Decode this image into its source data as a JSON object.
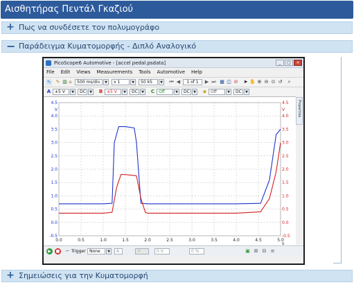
{
  "page": {
    "title": "Αισθητήρας Πεντάλ Γκαζιού",
    "sections": [
      {
        "label": "Πως να συνδέσετε τον πολυμογράφο",
        "symbol": "+"
      },
      {
        "label": "Παράδειγμα Κυματομορφής - Διπλό Αναλογικό",
        "symbol": "−"
      },
      {
        "label": "Σημειώσεις για την Κυματομορφή",
        "symbol": "+"
      }
    ]
  },
  "app": {
    "title": "PicoScope6 Automotive - [accel pedal.psdata]",
    "window_buttons": [
      "_",
      "□",
      "×"
    ],
    "menu": [
      "File",
      "Edit",
      "Views",
      "Measurements",
      "Tools",
      "Automotive",
      "Help"
    ],
    "toolbar1": {
      "timebase": "500 ms/div",
      "multiplier": "x 1",
      "samples": "50 kS",
      "buffer": "1 of 1"
    },
    "toolbar2": {
      "channel_a_label": "A",
      "channel_a_range": "±5 V",
      "channel_a_coupling": "DC",
      "channel_b_label": "B",
      "channel_b_range": "±5 V",
      "channel_b_coupling": "DC",
      "channel_c_label": "C",
      "channel_c_state": "Off",
      "channel_c_coupling": "DC",
      "channel_d_state": "Off",
      "channel_d_coupling": "DC"
    },
    "side_tab": "Properties",
    "statusbar": {
      "trigger_label": "Trigger",
      "trigger_value": "None",
      "channel": "A",
      "rise": "0 V",
      "pre": "0 %"
    },
    "colors": {
      "channel_a": "#1a33cc",
      "channel_b": "#d11f1f",
      "grid": "#b8b8b8"
    }
  },
  "chart_data": {
    "type": "line",
    "title": "",
    "xlabel": "s",
    "ylabel_left": "V",
    "ylabel_right": "V",
    "x_ticks": [
      "0.0",
      "0.5",
      "1.0",
      "1.5",
      "2.0",
      "2.5",
      "3.0",
      "3.5",
      "4.0",
      "4.5",
      "5.0"
    ],
    "y_ticks": [
      "-0.5",
      "0.0",
      "0.5",
      "1.0",
      "1.5",
      "2.0",
      "2.5",
      "3.0",
      "3.5",
      "4.0",
      "4.5"
    ],
    "xlim": [
      0,
      5
    ],
    "ylim": [
      -0.5,
      4.5
    ],
    "grid": true,
    "series": [
      {
        "id": "A",
        "color": "#1a33cc",
        "x": [
          0,
          0.5,
          1.0,
          1.2,
          1.25,
          1.35,
          1.5,
          1.7,
          1.75,
          1.85,
          2.0,
          3.0,
          4.0,
          4.55,
          4.75,
          4.9,
          5.0
        ],
        "y": [
          0.7,
          0.7,
          0.7,
          0.72,
          3.0,
          3.6,
          3.6,
          3.55,
          3.0,
          0.72,
          0.7,
          0.7,
          0.7,
          0.72,
          1.6,
          3.3,
          3.5
        ]
      },
      {
        "id": "B",
        "color": "#d11f1f",
        "x": [
          0,
          0.5,
          1.0,
          1.2,
          1.3,
          1.4,
          1.5,
          1.75,
          1.85,
          1.95,
          2.0,
          3.0,
          4.0,
          4.55,
          4.75,
          4.9,
          5.0
        ],
        "y": [
          0.35,
          0.35,
          0.35,
          0.38,
          1.3,
          1.8,
          1.8,
          1.75,
          0.9,
          0.38,
          0.35,
          0.35,
          0.35,
          0.4,
          0.9,
          1.9,
          3.0
        ]
      }
    ]
  }
}
